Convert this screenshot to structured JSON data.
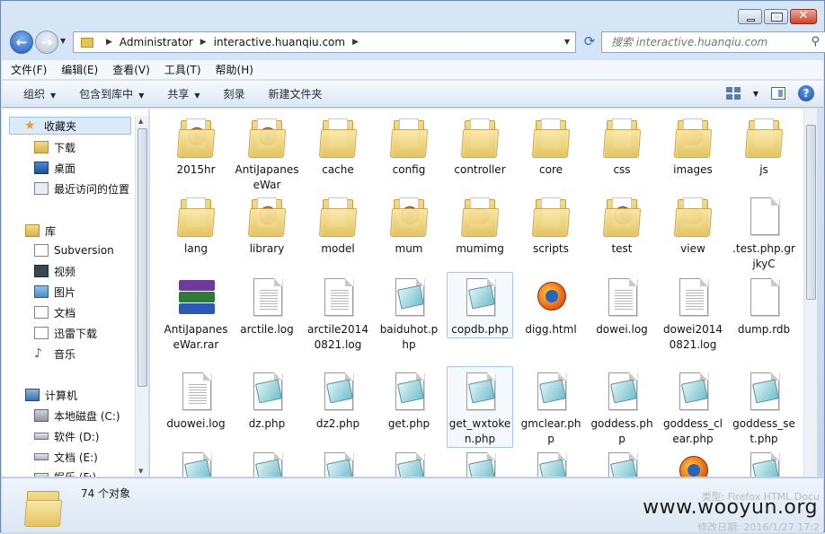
{
  "window": {
    "address_crumbs": [
      "Administrator",
      "interactive.huanqiu.com"
    ],
    "search_placeholder": "搜索 interactive.huanqiu.com"
  },
  "menu": [
    "文件(F)",
    "编辑(E)",
    "查看(V)",
    "工具(T)",
    "帮助(H)"
  ],
  "toolbar": {
    "organize": "组织",
    "include_in_library": "包含到库中",
    "share": "共享",
    "burn": "刻录",
    "new_folder": "新建文件夹"
  },
  "nav": {
    "favorites": "收藏夹",
    "downloads": "下载",
    "desktop": "桌面",
    "recent": "最近访问的位置",
    "libraries": "库",
    "subversion": "Subversion",
    "videos": "视频",
    "pictures": "图片",
    "documents": "文档",
    "thunder": "迅雷下载",
    "music": "音乐",
    "computer": "计算机",
    "drive_c": "本地磁盘 (C:)",
    "drive_d": "软件 (D:)",
    "drive_e": "文档 (E:)",
    "drive_f": "娱乐 (F:)"
  },
  "files": [
    {
      "name": "2015hr",
      "kind": "folder-ff"
    },
    {
      "name": "AntiJapaneseWar",
      "kind": "folder-ff"
    },
    {
      "name": "cache",
      "kind": "folder"
    },
    {
      "name": "config",
      "kind": "folder"
    },
    {
      "name": "controller",
      "kind": "folder"
    },
    {
      "name": "core",
      "kind": "folder"
    },
    {
      "name": "css",
      "kind": "folder"
    },
    {
      "name": "images",
      "kind": "folder-img"
    },
    {
      "name": "js",
      "kind": "folder"
    },
    {
      "name": "lang",
      "kind": "folder"
    },
    {
      "name": "library",
      "kind": "folder-ff"
    },
    {
      "name": "model",
      "kind": "folder"
    },
    {
      "name": "mum",
      "kind": "folder-ff"
    },
    {
      "name": "mumimg",
      "kind": "folder-img"
    },
    {
      "name": "scripts",
      "kind": "folder"
    },
    {
      "name": "test",
      "kind": "folder-ff"
    },
    {
      "name": "view",
      "kind": "folder-img"
    },
    {
      "name": ".test.php.grjkyC",
      "kind": "blank"
    },
    {
      "name": "AntiJapaneseWar.rar",
      "kind": "rar"
    },
    {
      "name": "arctile.log",
      "kind": "text"
    },
    {
      "name": "arctile20140821.log",
      "kind": "text"
    },
    {
      "name": "baiduhot.php",
      "kind": "php"
    },
    {
      "name": "copdb.php",
      "kind": "php",
      "hovered": true
    },
    {
      "name": "digg.html",
      "kind": "html"
    },
    {
      "name": "dowei.log",
      "kind": "text"
    },
    {
      "name": "dowei20140821.log",
      "kind": "text"
    },
    {
      "name": "dump.rdb",
      "kind": "blank"
    },
    {
      "name": "duowei.log",
      "kind": "text"
    },
    {
      "name": "dz.php",
      "kind": "php"
    },
    {
      "name": "dz2.php",
      "kind": "php"
    },
    {
      "name": "get.php",
      "kind": "php"
    },
    {
      "name": "get_wxtoken.php",
      "kind": "php",
      "hovered": true
    },
    {
      "name": "gmclear.php",
      "kind": "php"
    },
    {
      "name": "goddess.php",
      "kind": "php"
    },
    {
      "name": "goddess_clear.php",
      "kind": "php"
    },
    {
      "name": "goddess_set.php",
      "kind": "php"
    },
    {
      "name": "",
      "kind": "php"
    },
    {
      "name": "",
      "kind": "php"
    },
    {
      "name": "",
      "kind": "php"
    },
    {
      "name": "",
      "kind": "php"
    },
    {
      "name": "",
      "kind": "php"
    },
    {
      "name": "",
      "kind": "php"
    },
    {
      "name": "",
      "kind": "php"
    },
    {
      "name": "",
      "kind": "html"
    },
    {
      "name": "",
      "kind": "php"
    }
  ],
  "status": {
    "count": "74 个对象",
    "ghost_type": "类型: Firefox HTML Docu",
    "ghost_date": "修改日期: 2016/1/27 17:2",
    "watermark": "www.wooyun.org"
  }
}
